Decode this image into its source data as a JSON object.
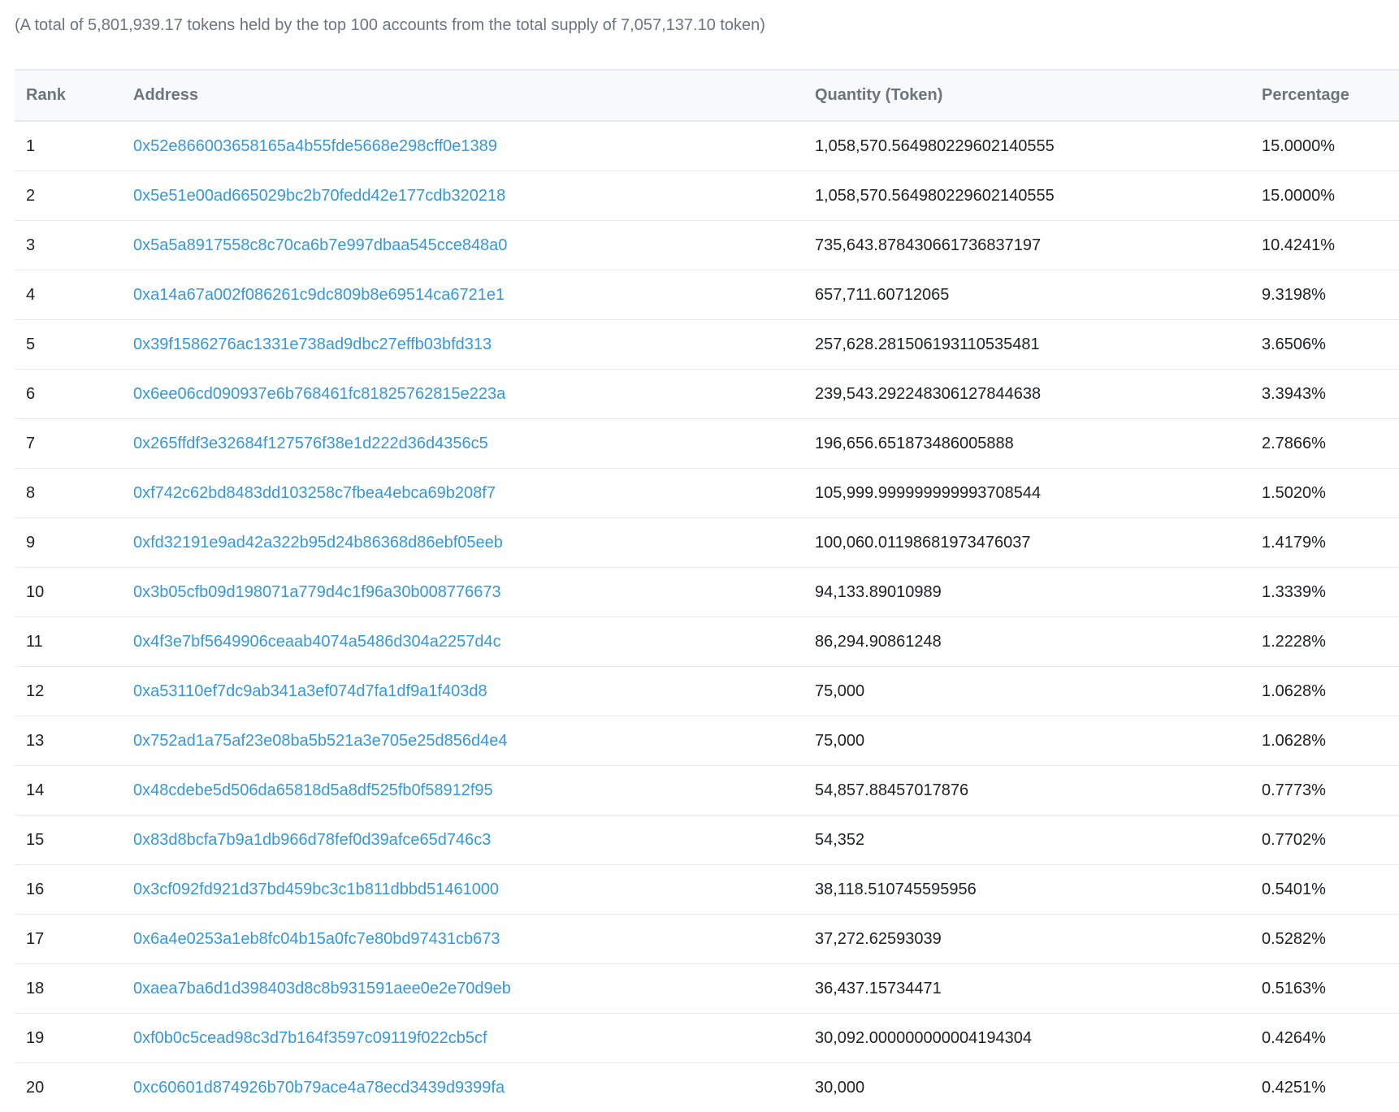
{
  "summary": "(A total of 5,801,939.17 tokens held by the top 100 accounts from the total supply of 7,057,137.10 token)",
  "table": {
    "headers": {
      "rank": "Rank",
      "address": "Address",
      "quantity": "Quantity (Token)",
      "percentage": "Percentage"
    },
    "rows": [
      {
        "rank": "1",
        "address": "0x52e866003658165a4b55fde5668e298cff0e1389",
        "quantity": "1,058,570.564980229602140555",
        "percentage": "15.0000%"
      },
      {
        "rank": "2",
        "address": "0x5e51e00ad665029bc2b70fedd42e177cdb320218",
        "quantity": "1,058,570.564980229602140555",
        "percentage": "15.0000%"
      },
      {
        "rank": "3",
        "address": "0x5a5a8917558c8c70ca6b7e997dbaa545cce848a0",
        "quantity": "735,643.878430661736837197",
        "percentage": "10.4241%"
      },
      {
        "rank": "4",
        "address": "0xa14a67a002f086261c9dc809b8e69514ca6721e1",
        "quantity": "657,711.60712065",
        "percentage": "9.3198%"
      },
      {
        "rank": "5",
        "address": "0x39f1586276ac1331e738ad9dbc27effb03bfd313",
        "quantity": "257,628.281506193110535481",
        "percentage": "3.6506%"
      },
      {
        "rank": "6",
        "address": "0x6ee06cd090937e6b768461fc81825762815e223a",
        "quantity": "239,543.292248306127844638",
        "percentage": "3.3943%"
      },
      {
        "rank": "7",
        "address": "0x265ffdf3e32684f127576f38e1d222d36d4356c5",
        "quantity": "196,656.651873486005888",
        "percentage": "2.7866%"
      },
      {
        "rank": "8",
        "address": "0xf742c62bd8483dd103258c7fbea4ebca69b208f7",
        "quantity": "105,999.999999999993708544",
        "percentage": "1.5020%"
      },
      {
        "rank": "9",
        "address": "0xfd32191e9ad42a322b95d24b86368d86ebf05eeb",
        "quantity": "100,060.01198681973476037",
        "percentage": "1.4179%"
      },
      {
        "rank": "10",
        "address": "0x3b05cfb09d198071a779d4c1f96a30b008776673",
        "quantity": "94,133.89010989",
        "percentage": "1.3339%"
      },
      {
        "rank": "11",
        "address": "0x4f3e7bf5649906ceaab4074a5486d304a2257d4c",
        "quantity": "86,294.90861248",
        "percentage": "1.2228%"
      },
      {
        "rank": "12",
        "address": "0xa53110ef7dc9ab341a3ef074d7fa1df9a1f403d8",
        "quantity": "75,000",
        "percentage": "1.0628%"
      },
      {
        "rank": "13",
        "address": "0x752ad1a75af23e08ba5b521a3e705e25d856d4e4",
        "quantity": "75,000",
        "percentage": "1.0628%"
      },
      {
        "rank": "14",
        "address": "0x48cdebe5d506da65818d5a8df525fb0f58912f95",
        "quantity": "54,857.88457017876",
        "percentage": "0.7773%"
      },
      {
        "rank": "15",
        "address": "0x83d8bcfa7b9a1db966d78fef0d39afce65d746c3",
        "quantity": "54,352",
        "percentage": "0.7702%"
      },
      {
        "rank": "16",
        "address": "0x3cf092fd921d37bd459bc3c1b811dbbd51461000",
        "quantity": "38,118.510745595956",
        "percentage": "0.5401%"
      },
      {
        "rank": "17",
        "address": "0x6a4e0253a1eb8fc04b15a0fc7e80bd97431cb673",
        "quantity": "37,272.62593039",
        "percentage": "0.5282%"
      },
      {
        "rank": "18",
        "address": "0xaea7ba6d1d398403d8c8b931591aee0e2e70d9eb",
        "quantity": "36,437.15734471",
        "percentage": "0.5163%"
      },
      {
        "rank": "19",
        "address": "0xf0b0c5cead98c3d7b164f3597c09119f022cb5cf",
        "quantity": "30,092.000000000004194304",
        "percentage": "0.4264%"
      },
      {
        "rank": "20",
        "address": "0xc60601d874926b70b79ace4a78ecd3439d9399fa",
        "quantity": "30,000",
        "percentage": "0.4251%"
      }
    ]
  },
  "colors": {
    "link": "#3498db",
    "muted_text": "#6c757e",
    "header_bg": "#f8f9fa",
    "border": "#e7eaf3"
  }
}
